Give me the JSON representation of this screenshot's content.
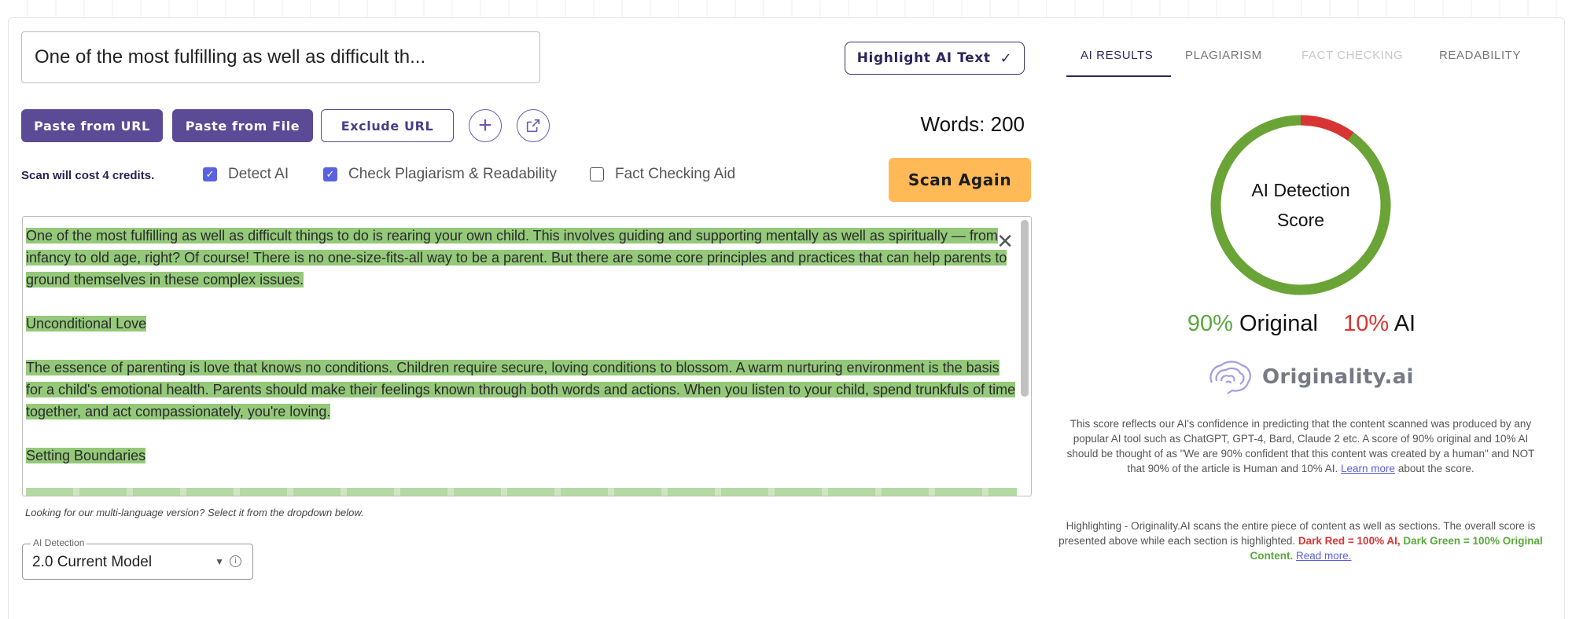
{
  "input": {
    "title_value": "One of the most fulfilling as well as difficult th..."
  },
  "buttons": {
    "highlight_ai": "Highlight AI Text",
    "highlight_check": "✓",
    "paste_url": "Paste from URL",
    "paste_file": "Paste from File",
    "exclude_url": "Exclude URL",
    "scan_again": "Scan Again"
  },
  "words_label": "Words: 200",
  "scan_cost": "Scan will cost 4 credits.",
  "options": [
    {
      "label": "Detect AI",
      "checked": true
    },
    {
      "label": "Check Plagiarism & Readability",
      "checked": true
    },
    {
      "label": "Fact Checking Aid",
      "checked": false
    }
  ],
  "editor": {
    "paragraphs": [
      "One of the most fulfilling as well as difficult things to do is rearing your own child. This involves guiding and supporting mentally as well as spiritually — from infancy to old age, right? Of course! There is no one-size-fits-all way to be a parent. But there are some core principles and practices that can help parents to ground themselves in these complex issues.",
      "Unconditional Love",
      "The essence of parenting is love that knows no conditions. Children require secure, loving conditions to blossom. A warm nurturing environment is the basis for a child's emotional health. Parents should make their feelings known through both words and actions. When you listen to your child, spend trunkfuls of time together, and act compassionately, you're loving.",
      "Setting Boundaries"
    ],
    "highlight_color": "#94c97a"
  },
  "language_note": "Looking for our multi-language version? Select it from the dropdown below.",
  "model_select": {
    "legend": "AI Detection",
    "value": "2.0 Current Model"
  },
  "tabs": [
    {
      "label": "AI RESULTS",
      "state": "active"
    },
    {
      "label": "PLAGIARISM",
      "state": "normal"
    },
    {
      "label": "FACT CHECKING",
      "state": "disabled"
    },
    {
      "label": "READABILITY",
      "state": "normal"
    }
  ],
  "score": {
    "donut_label_line1": "AI Detection",
    "donut_label_line2": "Score",
    "original_pct": "90%",
    "original_label": "Original",
    "ai_pct": "10%",
    "ai_label": "AI",
    "original_value": 90,
    "ai_value": 10,
    "original_color": "#6aa436",
    "ai_color": "#d93434"
  },
  "brand": "Originality.ai",
  "description": {
    "text_before": "This score reflects our AI's confidence in predicting that the content scanned was produced by any popular AI tool such as ChatGPT, GPT-4, Bard, Claude 2 etc. A score of 90% original and 10% AI should be thought of as \"We are 90% confident that this content was created by a human\" and NOT that 90% of the article is Human and 10% AI. Learn more about the score.",
    "learn_more": "Learn more",
    "text_after": "about the score.",
    "highlighting_text": "Highlighting - Originality.AI scans the entire piece of content as well as sections. The overall score is presented above while each section is highlighted.",
    "dark_red": "Dark Red = 100% AI,",
    "dark_green": "Dark Green = 100% Original Content.",
    "read_more": "Read more."
  }
}
